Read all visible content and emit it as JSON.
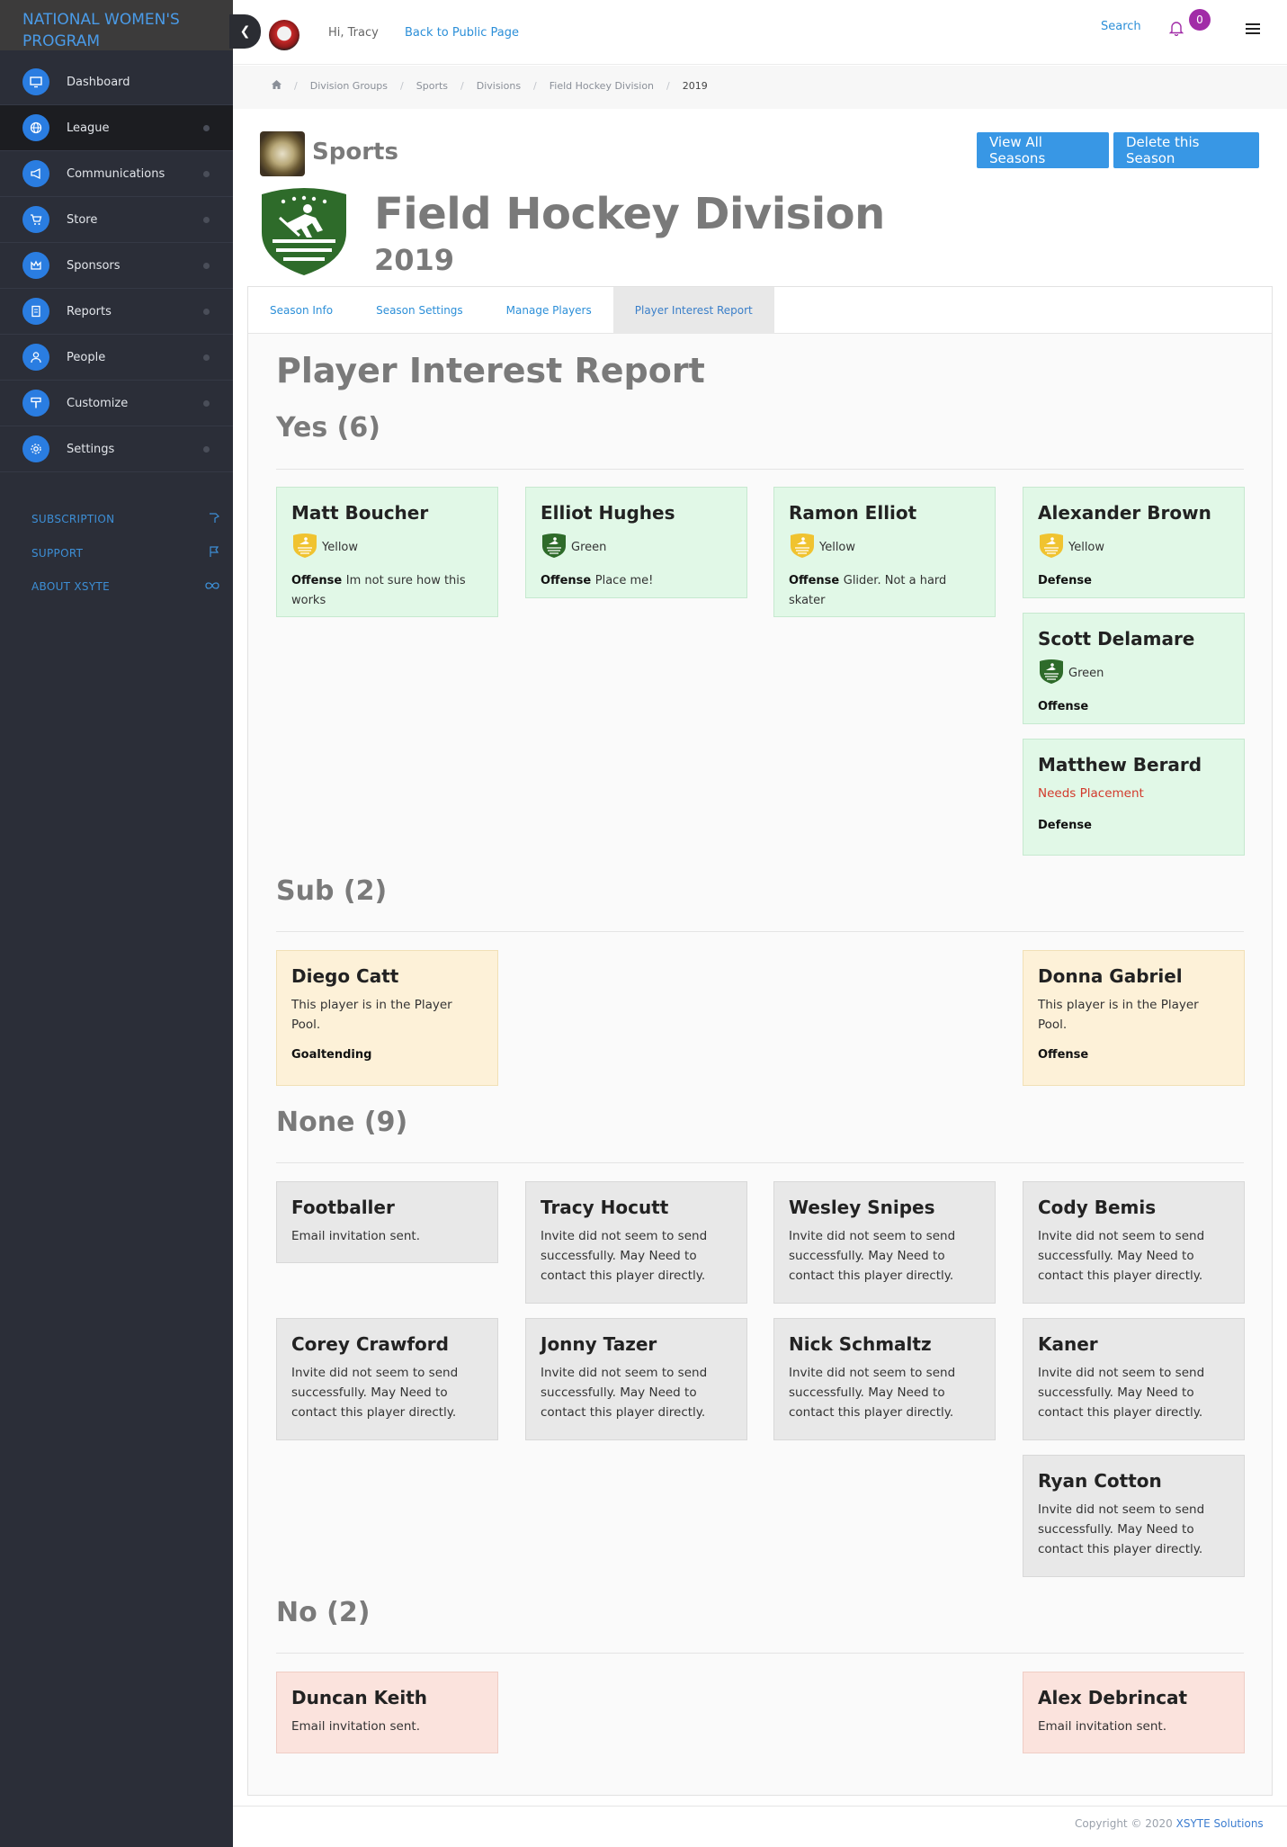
{
  "brand": {
    "title": "NATIONAL WOMEN'S PROGRAM"
  },
  "sidebar": {
    "items": [
      {
        "label": "Dashboard",
        "icon": "monitor-icon"
      },
      {
        "label": "League",
        "icon": "globe-icon"
      },
      {
        "label": "Communications",
        "icon": "megaphone-icon"
      },
      {
        "label": "Store",
        "icon": "cart-icon"
      },
      {
        "label": "Sponsors",
        "icon": "crown-icon"
      },
      {
        "label": "Reports",
        "icon": "reports-icon"
      },
      {
        "label": "People",
        "icon": "person-icon"
      },
      {
        "label": "Customize",
        "icon": "paint-roller-icon"
      },
      {
        "label": "Settings",
        "icon": "gear-icon"
      }
    ],
    "links": [
      {
        "label": "SUBSCRIPTION",
        "icon": "hand-icon"
      },
      {
        "label": "SUPPORT",
        "icon": "flag-icon"
      },
      {
        "label": "ABOUT XSYTE",
        "icon": "infinity-icon"
      }
    ]
  },
  "topbar": {
    "greeting": "Hi, Tracy",
    "back_link": "Back to Public Page",
    "search": "Search",
    "notifications": "0"
  },
  "breadcrumb": [
    "Division Groups",
    "Sports",
    "Divisions",
    "Field Hockey Division",
    "2019"
  ],
  "header": {
    "group": "Sports",
    "division": "Field Hockey Division",
    "year": "2019",
    "btn_view": "View All Seasons",
    "btn_delete": "Delete this Season"
  },
  "tabs": [
    "Season Info",
    "Season Settings",
    "Manage Players",
    "Player Interest Report"
  ],
  "report": {
    "title": "Player Interest Report",
    "yes": {
      "heading": "Yes (6)",
      "players": [
        {
          "name": "Matt Boucher",
          "team": "Yellow",
          "position": "Offense",
          "note": "Im not sure how this works"
        },
        {
          "name": "Elliot Hughes",
          "team": "Green",
          "position": "Offense",
          "note": "Place me!"
        },
        {
          "name": "Ramon Elliot",
          "team": "Yellow",
          "position": "Offense",
          "note": "Glider. Not a hard skater"
        },
        {
          "name": "Alexander Brown",
          "team": "Yellow",
          "position": "Defense",
          "note": ""
        },
        {
          "name": "Scott Delamare",
          "team": "Green",
          "position": "Offense",
          "note": ""
        },
        {
          "name": "Matthew Berard",
          "status": "Needs Placement",
          "position": "Defense"
        }
      ]
    },
    "sub": {
      "heading": "Sub (2)",
      "players": [
        {
          "name": "Diego Catt",
          "message": "This player is in the Player Pool.",
          "position": "Goaltending"
        },
        {
          "name": "Donna Gabriel",
          "message": "This player is in the Player Pool.",
          "position": "Offense"
        }
      ]
    },
    "none": {
      "heading": "None (9)",
      "players": [
        {
          "name": "Footballer",
          "message": "Email invitation sent."
        },
        {
          "name": "Tracy Hocutt",
          "message": "Invite did not seem to send successfully. May Need to contact this player directly."
        },
        {
          "name": "Wesley Snipes",
          "message": "Invite did not seem to send successfully. May Need to contact this player directly."
        },
        {
          "name": "Cody Bemis",
          "message": "Invite did not seem to send successfully. May Need to contact this player directly."
        },
        {
          "name": "Corey Crawford",
          "message": "Invite did not seem to send successfully. May Need to contact this player directly."
        },
        {
          "name": "Jonny Tazer",
          "message": "Invite did not seem to send successfully. May Need to contact this player directly."
        },
        {
          "name": "Nick Schmaltz",
          "message": "Invite did not seem to send successfully. May Need to contact this player directly."
        },
        {
          "name": "Kaner",
          "message": "Invite did not seem to send successfully. May Need to contact this player directly."
        },
        {
          "name": "Ryan Cotton",
          "message": "Invite did not seem to send successfully. May Need to contact this player directly."
        }
      ]
    },
    "no": {
      "heading": "No (2)",
      "players": [
        {
          "name": "Duncan Keith",
          "message": "Email invitation sent."
        },
        {
          "name": "Alex Debrincat",
          "message": "Email invitation sent."
        }
      ]
    }
  },
  "footer": {
    "copyright": "Copyright © 2020",
    "company": "XSYTE Solutions"
  },
  "colors": {
    "accent": "#3897e5",
    "sidebar": "#2b2e38",
    "yes": "#e1f8e7",
    "sub": "#fdf1d8",
    "none": "#e8e8e8",
    "no": "#fbe3dd",
    "badge": "#a12ca7"
  }
}
